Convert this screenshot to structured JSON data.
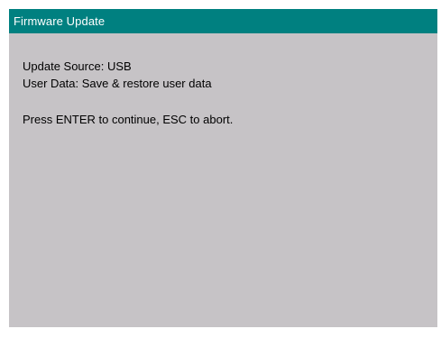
{
  "window": {
    "title": "Firmware Update"
  },
  "content": {
    "update_source": "Update Source: USB",
    "user_data": "User Data: Save & restore user data",
    "prompt": "Press ENTER to continue, ESC to abort."
  },
  "colors": {
    "titlebar_bg": "#008080",
    "title_text": "#ffffff",
    "panel_bg": "#c6c3c6",
    "body_text": "#000000"
  }
}
